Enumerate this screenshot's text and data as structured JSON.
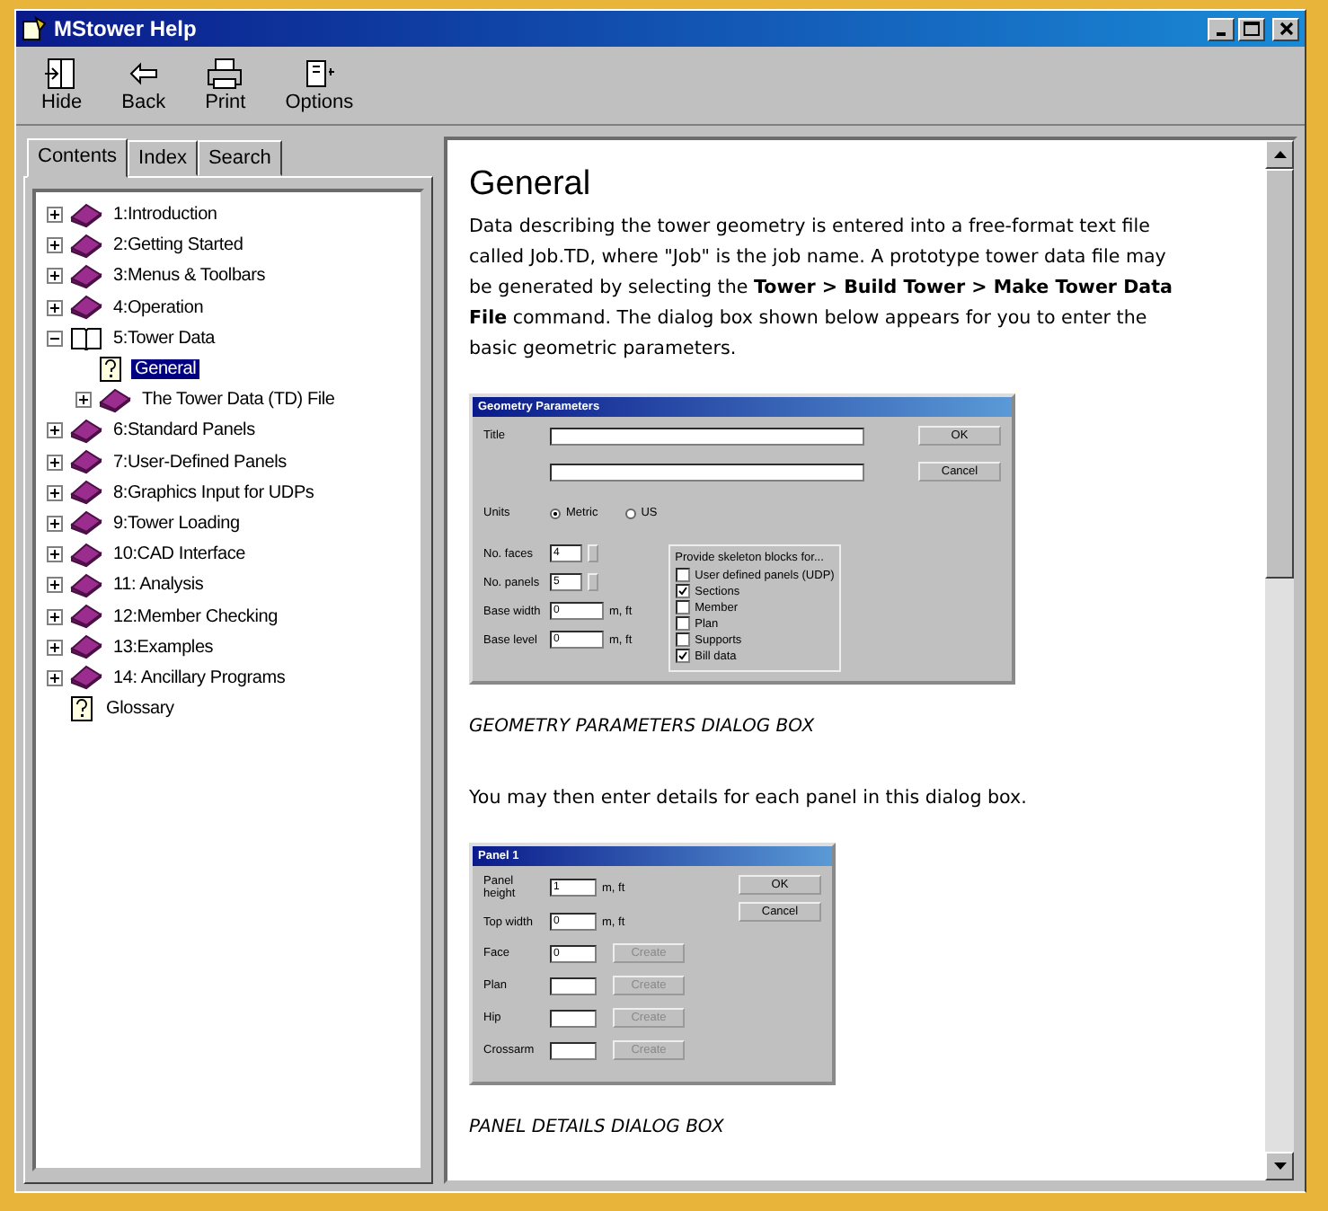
{
  "window": {
    "title": "MStower Help"
  },
  "toolbar": [
    {
      "kind": "hide",
      "label": "Hide"
    },
    {
      "kind": "back",
      "label": "Back"
    },
    {
      "kind": "print",
      "label": "Print"
    },
    {
      "kind": "options",
      "label": "Options"
    }
  ],
  "tabs": [
    {
      "label": "Contents",
      "selected": true
    },
    {
      "label": "Index",
      "selected": false
    },
    {
      "label": "Search",
      "selected": false
    }
  ],
  "tree": [
    {
      "kind": "book",
      "label": "1:Introduction",
      "expanded": false,
      "selected": false
    },
    {
      "kind": "book",
      "label": "2:Getting Started",
      "expanded": false,
      "selected": false
    },
    {
      "kind": "book",
      "label": "3:Menus & Toolbars",
      "expanded": false,
      "selected": false
    },
    {
      "kind": "book",
      "label": "4:Operation",
      "expanded": false,
      "selected": false
    },
    {
      "kind": "book",
      "label": "5:Tower Data",
      "expanded": true,
      "selected": false,
      "children": [
        {
          "kind": "page",
          "label": "General",
          "selected": true
        },
        {
          "kind": "book",
          "label": "The Tower Data (TD) File",
          "expanded": false,
          "selected": false
        }
      ]
    },
    {
      "kind": "book",
      "label": "6:Standard Panels",
      "expanded": false,
      "selected": false
    },
    {
      "kind": "book",
      "label": "7:User-Defined Panels",
      "expanded": false,
      "selected": false
    },
    {
      "kind": "book",
      "label": "8:Graphics Input for UDPs",
      "expanded": false,
      "selected": false
    },
    {
      "kind": "book",
      "label": "9:Tower Loading",
      "expanded": false,
      "selected": false
    },
    {
      "kind": "book",
      "label": "10:CAD Interface",
      "expanded": false,
      "selected": false
    },
    {
      "kind": "book",
      "label": "11: Analysis",
      "expanded": false,
      "selected": false
    },
    {
      "kind": "book",
      "label": "12:Member Checking",
      "expanded": false,
      "selected": false
    },
    {
      "kind": "book",
      "label": "13:Examples",
      "expanded": false,
      "selected": false
    },
    {
      "kind": "book",
      "label": "14: Ancillary Programs",
      "expanded": false,
      "selected": false
    },
    {
      "kind": "page",
      "label": "Glossary",
      "selected": false
    }
  ],
  "topic": {
    "title": "General",
    "body": [
      {
        "kind": "paragraph",
        "text": "Data describing the tower geometry is entered into a free-format text file called Job.TD, where \"Job\" is the job name. A prototype tower data file may be generated by selecting the **Tower > Build Tower > Make Tower Data File** command. The dialog box shown below appears for you to enter the basic geometric parameters."
      },
      {
        "kind": "geometry_dialog",
        "title": "Geometry Parameters",
        "title_label": "Title",
        "ok": "OK",
        "cancel": "Cancel",
        "units_label": "Units",
        "units": [
          {
            "label": "Metric",
            "selected": true
          },
          {
            "label": "US",
            "selected": false
          }
        ],
        "fields": [
          {
            "label": "No. faces",
            "value": "4",
            "kind": "spin"
          },
          {
            "label": "No. panels",
            "value": "5",
            "kind": "spin"
          },
          {
            "label": "Base width",
            "value": "0",
            "unit": "m, ft",
            "kind": "text"
          },
          {
            "label": "Base level",
            "value": "0",
            "unit": "m, ft",
            "kind": "text"
          }
        ],
        "group_label": "Provide skeleton blocks for...",
        "checks": [
          {
            "label": "User defined panels (UDP)",
            "checked": false
          },
          {
            "label": "Sections",
            "checked": true
          },
          {
            "label": "Member",
            "checked": false
          },
          {
            "label": "Plan",
            "checked": false
          },
          {
            "label": "Supports",
            "checked": false
          },
          {
            "label": "Bill data",
            "checked": true
          }
        ]
      },
      {
        "kind": "caption",
        "text": "GEOMETRY PARAMETERS DIALOG BOX"
      },
      {
        "kind": "paragraph",
        "text": "You may then enter details for each panel in this dialog box."
      },
      {
        "kind": "panel_dialog",
        "title": "Panel 1",
        "ok": "OK",
        "cancel": "Cancel",
        "fields": [
          {
            "label": "Panel height",
            "value": "1",
            "unit": "m, ft"
          },
          {
            "label": "Top width",
            "value": "0",
            "unit": "m, ft"
          },
          {
            "label": "Face",
            "value": "0",
            "button": "Create"
          },
          {
            "label": "Plan",
            "button": "Create"
          },
          {
            "label": "Hip",
            "button": "Create"
          },
          {
            "label": "Crossarm",
            "button": "Create"
          }
        ]
      },
      {
        "kind": "caption",
        "text": "PANEL DETAILS DIALOG BOX"
      }
    ]
  }
}
